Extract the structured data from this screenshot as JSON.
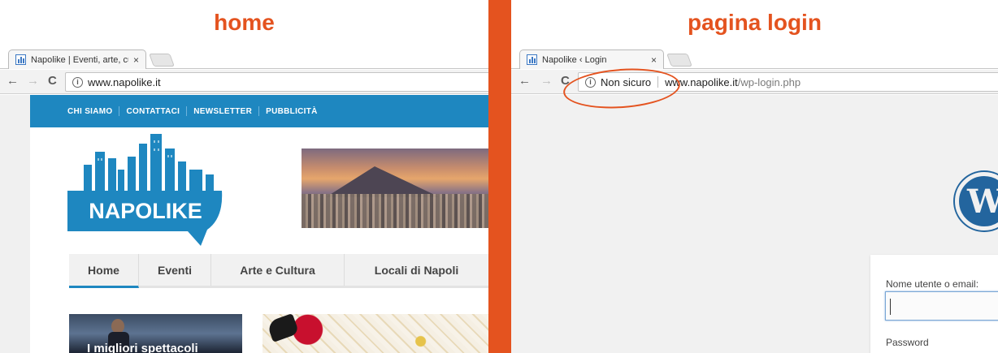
{
  "left": {
    "heading": "home",
    "tab": {
      "title": "Napolike | Eventi, arte, cu",
      "close": "×"
    },
    "toolbar": {
      "back": "←",
      "forward": "→",
      "reload": "C",
      "url": "www.napolike.it"
    },
    "site": {
      "top_links": [
        "CHI SIAMO",
        "CONTATTACI",
        "NEWSLETTER",
        "PUBBLICITÀ"
      ],
      "logo_text": "NAPOLIKE",
      "main_menu": [
        "Home",
        "Eventi",
        "Arte e Cultura",
        "Locali di Napoli"
      ],
      "active_menu": "Home",
      "article_caption": "I migliori spettacoli"
    },
    "colors": {
      "brand": "#1e87c0",
      "accent": "#e4531f"
    }
  },
  "right": {
    "heading": "pagina login",
    "tab": {
      "title": "Napolike ‹ Login",
      "close": "×"
    },
    "toolbar": {
      "back": "←",
      "forward": "→",
      "reload": "C",
      "security_label": "Non sicuro",
      "url_host": "www.napolike.it",
      "url_path": "/wp-login.php"
    },
    "login": {
      "wp_logo_letter": "W",
      "username_label": "Nome utente o email:",
      "password_label": "Password"
    }
  }
}
